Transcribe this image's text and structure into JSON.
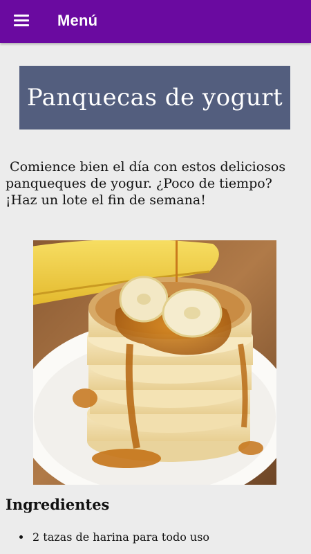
{
  "appbar": {
    "menu_icon": "hamburger-menu-icon",
    "title": "Menú",
    "color": "#6a0aa0"
  },
  "recipe": {
    "title": "Panquecas de yogurt",
    "title_bg": "#535e7e",
    "intro": " Comience bien el día con estos deliciosos panqueques de yogur. ¿Poco de tiempo? ¡Haz un lote el fin de semana!",
    "image": "pancake-stack-with-banana-and-syrup-image"
  },
  "ingredients": {
    "heading": "Ingredientes",
    "items": [
      "2 tazas de harina para todo uso"
    ]
  }
}
